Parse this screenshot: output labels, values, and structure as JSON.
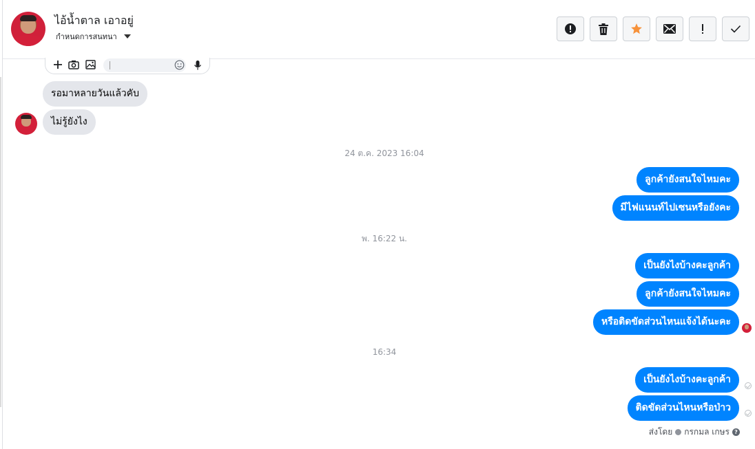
{
  "contact": {
    "name": "ไอ้น้ำตาล เอาอยู่",
    "assign_label": "กำหนดการสนทนา"
  },
  "toolbar": {
    "buttons": [
      {
        "icon": "alert-circle-icon",
        "label": "!"
      },
      {
        "icon": "trash-icon",
        "label": ""
      },
      {
        "icon": "star-icon",
        "label": ""
      },
      {
        "icon": "envelope-icon",
        "label": ""
      },
      {
        "icon": "exclamation-icon",
        "label": "!"
      },
      {
        "icon": "check-icon",
        "label": ""
      }
    ],
    "star_color": "#f7923b"
  },
  "composer": {
    "icons": [
      "plus-icon",
      "camera-icon",
      "image-icon",
      "emoji-icon",
      "microphone-icon"
    ]
  },
  "messages": {
    "incoming": [
      {
        "text": "รอมาหลายวันแล้วคับ"
      },
      {
        "text": "ไม่รู้ยังไง"
      }
    ],
    "groups": [
      {
        "timestamp": "24 ต.ค. 2023 16:04",
        "messages": [
          "ลูกค้ายังสนใจไหมคะ",
          "มีไฟแนนท์ไปเซนหรือยังคะ"
        ]
      },
      {
        "timestamp": "พ. 16:22 น.",
        "messages": [
          "เป็นยังไงบ้างคะลูกค้า",
          "ลูกค้ายังสนใจไหมคะ",
          "หรือติดขัดส่วนไหนแจ้งได้นะคะ"
        ]
      },
      {
        "timestamp": "16:34",
        "messages": [
          "เป็นยังไงบ้างคะลูกค้า",
          "ติดขัดส่วนไหนหรือป่าว"
        ]
      }
    ],
    "outgoing_color": "#0084ff",
    "incoming_color": "#e4e6eb"
  },
  "footer": {
    "sent_by_label": "ส่งโดย",
    "sender_name": "กรกมล เกษร"
  }
}
